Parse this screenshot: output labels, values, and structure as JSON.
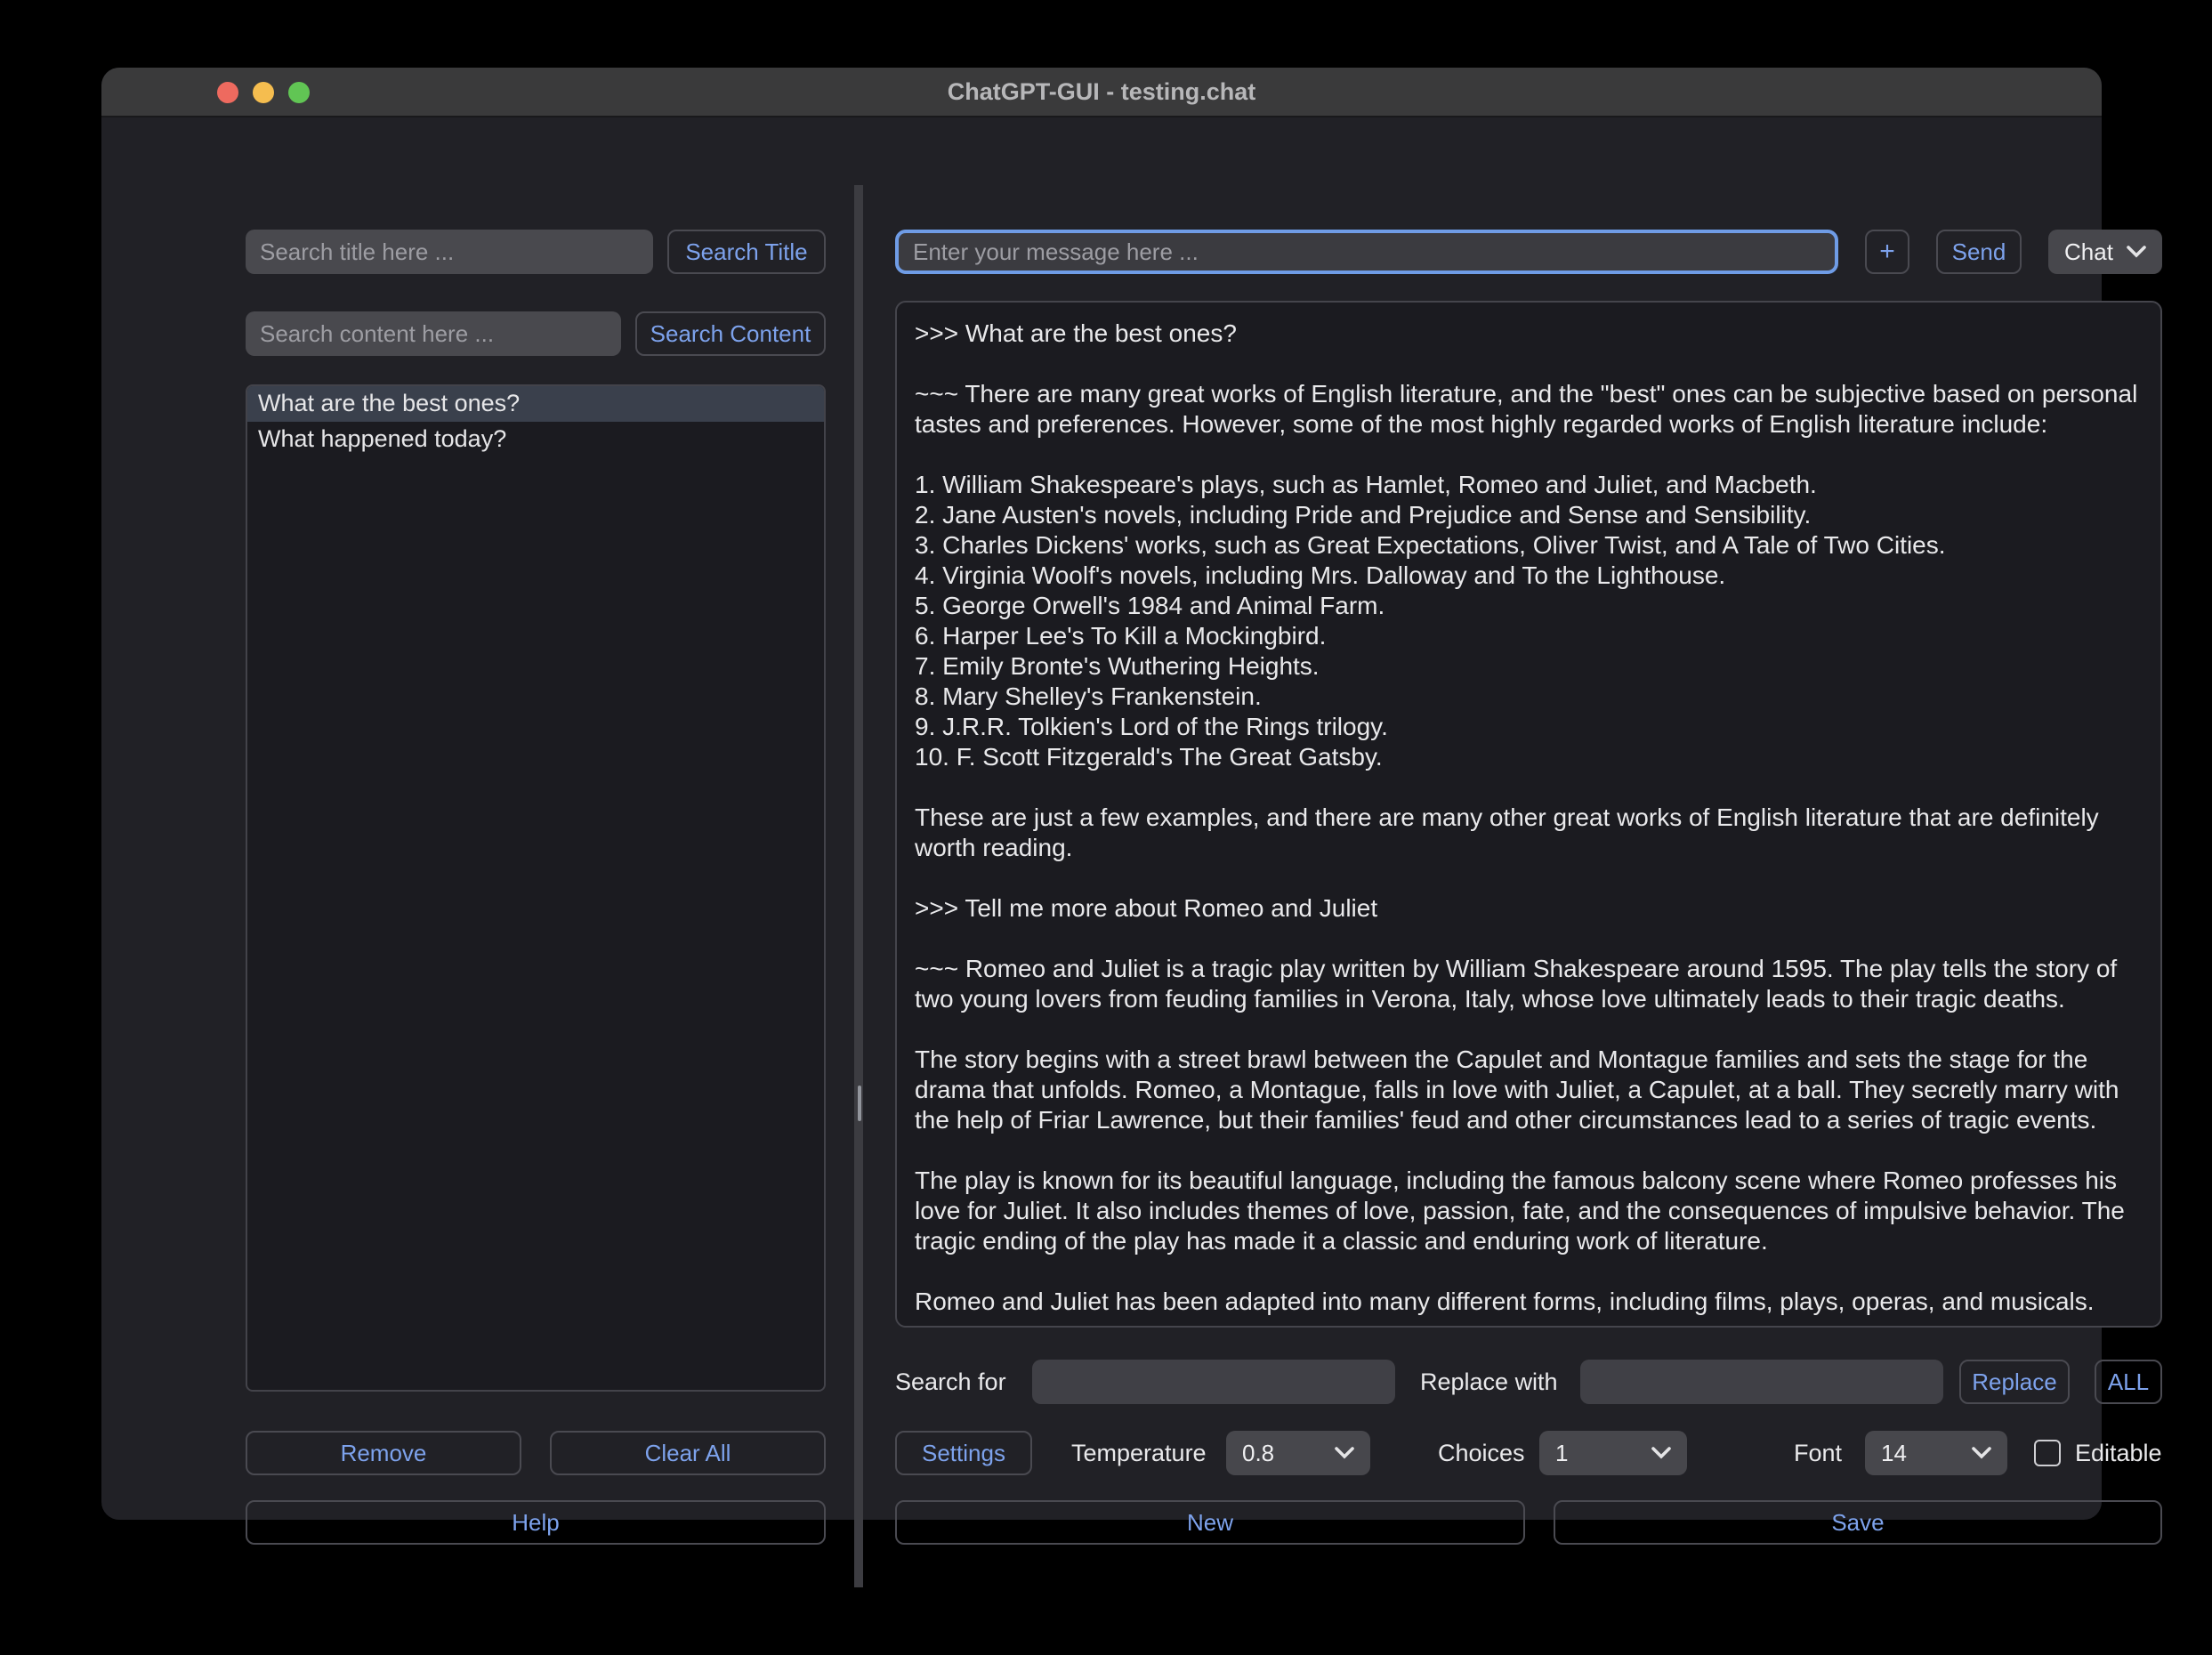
{
  "window": {
    "title": "ChatGPT-GUI - testing.chat"
  },
  "sidebar": {
    "search_title": {
      "placeholder": "Search title here ...",
      "button": "Search Title"
    },
    "search_content": {
      "placeholder": "Search content here ...",
      "button": "Search Content"
    },
    "chat_list": [
      {
        "label": "What are the best ones?",
        "selected": true
      },
      {
        "label": "What happened today?",
        "selected": false
      }
    ],
    "remove_button": "Remove",
    "clear_all_button": "Clear All",
    "help_button": "Help"
  },
  "main": {
    "message_input": {
      "placeholder": "Enter your message here ...",
      "value": ""
    },
    "add_button": "+",
    "send_button": "Send",
    "mode_select": {
      "value": "Chat"
    },
    "conversation": ">>> What are the best ones?\n\n~~~ There are many great works of English literature, and the \"best\" ones can be subjective based on personal tastes and preferences. However, some of the most highly regarded works of English literature include:\n\n1. William Shakespeare's plays, such as Hamlet, Romeo and Juliet, and Macbeth.\n2. Jane Austen's novels, including Pride and Prejudice and Sense and Sensibility.\n3. Charles Dickens' works, such as Great Expectations, Oliver Twist, and A Tale of Two Cities.\n4. Virginia Woolf's novels, including Mrs. Dalloway and To the Lighthouse.\n5. George Orwell's 1984 and Animal Farm.\n6. Harper Lee's To Kill a Mockingbird.\n7. Emily Bronte's Wuthering Heights.\n8. Mary Shelley's Frankenstein.\n9. J.R.R. Tolkien's Lord of the Rings trilogy.\n10. F. Scott Fitzgerald's The Great Gatsby.\n\nThese are just a few examples, and there are many other great works of English literature that are definitely worth reading.\n\n>>> Tell me more about Romeo and Juliet\n\n~~~ Romeo and Juliet is a tragic play written by William Shakespeare around 1595. The play tells the story of two young lovers from feuding families in Verona, Italy, whose love ultimately leads to their tragic deaths.\n\nThe story begins with a street brawl between the Capulet and Montague families and sets the stage for the drama that unfolds. Romeo, a Montague, falls in love with Juliet, a Capulet, at a ball. They secretly marry with the help of Friar Lawrence, but their families' feud and other circumstances lead to a series of tragic events.\n\nThe play is known for its beautiful language, including the famous balcony scene where Romeo professes his love for Juliet. It also includes themes of love, passion, fate, and the consequences of impulsive behavior. The tragic ending of the play has made it a classic and enduring work of literature.\n\nRomeo and Juliet has been adapted into many different forms, including films, plays, operas, and musicals.",
    "find_replace": {
      "search_label": "Search for",
      "search_value": "",
      "replace_label": "Replace with",
      "replace_value": "",
      "replace_button": "Replace",
      "all_button": "ALL"
    },
    "settings": {
      "settings_button": "Settings",
      "temperature_label": "Temperature",
      "temperature_value": "0.8",
      "choices_label": "Choices",
      "choices_value": "1",
      "font_label": "Font",
      "font_value": "14",
      "editable_label": "Editable",
      "editable_checked": false
    },
    "new_button": "New",
    "save_button": "Save"
  },
  "colors": {
    "accent_blue_text": "#7da2ec",
    "focus_border": "#6f9ce6",
    "titlebar": "#3a3a3b",
    "panel_bg": "#212126",
    "field_bg": "#49494e",
    "dark_area_bg": "#1b1b20",
    "selected_row": "#3a404c",
    "traffic_red": "#ee6a5f",
    "traffic_yellow": "#f5bd4f",
    "traffic_green": "#61c554"
  }
}
